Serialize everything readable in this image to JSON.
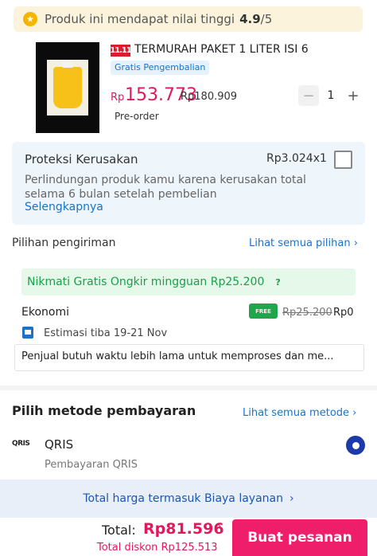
{
  "rating": {
    "text": "Produk ini mendapat nilai tinggi",
    "score": "4.9",
    "scale": "/5"
  },
  "product": {
    "badge": "11.11",
    "title": "TERMURAH PAKET 1 LITER ISI 6",
    "return_tag": "Gratis Pengembalian",
    "price_currency": "Rp",
    "price": "153.773",
    "old_price": "Rp180.909",
    "status": "Pre-order",
    "quantity": "1",
    "qty_minus": "−",
    "qty_plus": "+"
  },
  "protection": {
    "title": "Proteksi Kerusakan",
    "price": "Rp3.024x1",
    "description": "Perlindungan produk kamu karena kerusakan total selama 6 bulan setelah pembelian",
    "more_link": "Selengkapnya"
  },
  "shipping": {
    "title": "Pilihan pengiriman",
    "see_all": "Lihat semua pilihan ›",
    "promo": "Nikmati Gratis Ongkir mingguan Rp25.200",
    "promo_help": "?",
    "option_name": "Ekonomi",
    "free_tag": "FREE",
    "old_cost": "Rp25.200",
    "new_cost": "Rp0",
    "eta": "Estimasi tiba 19-21 Nov",
    "note": "Penjual butuh waktu lebih lama untuk memproses dan me..."
  },
  "payment": {
    "title": "Pilih metode pembayaran",
    "see_all": "Lihat semua metode ›",
    "method_logo": "QRIS",
    "method_name": "QRIS",
    "method_desc": "Pembayaran QRIS"
  },
  "fee_bar": {
    "text": "Total harga termasuk Biaya layanan",
    "chevron": "›"
  },
  "footer": {
    "total_label": "Total:",
    "total_value": "Rp81.596",
    "caret": "^",
    "discount": "Total diskon Rp125.513",
    "order_button": "Buat pesanan"
  },
  "colors": {
    "accent": "#ef1e6b",
    "link": "#1a73c8",
    "success": "#19a04a"
  }
}
